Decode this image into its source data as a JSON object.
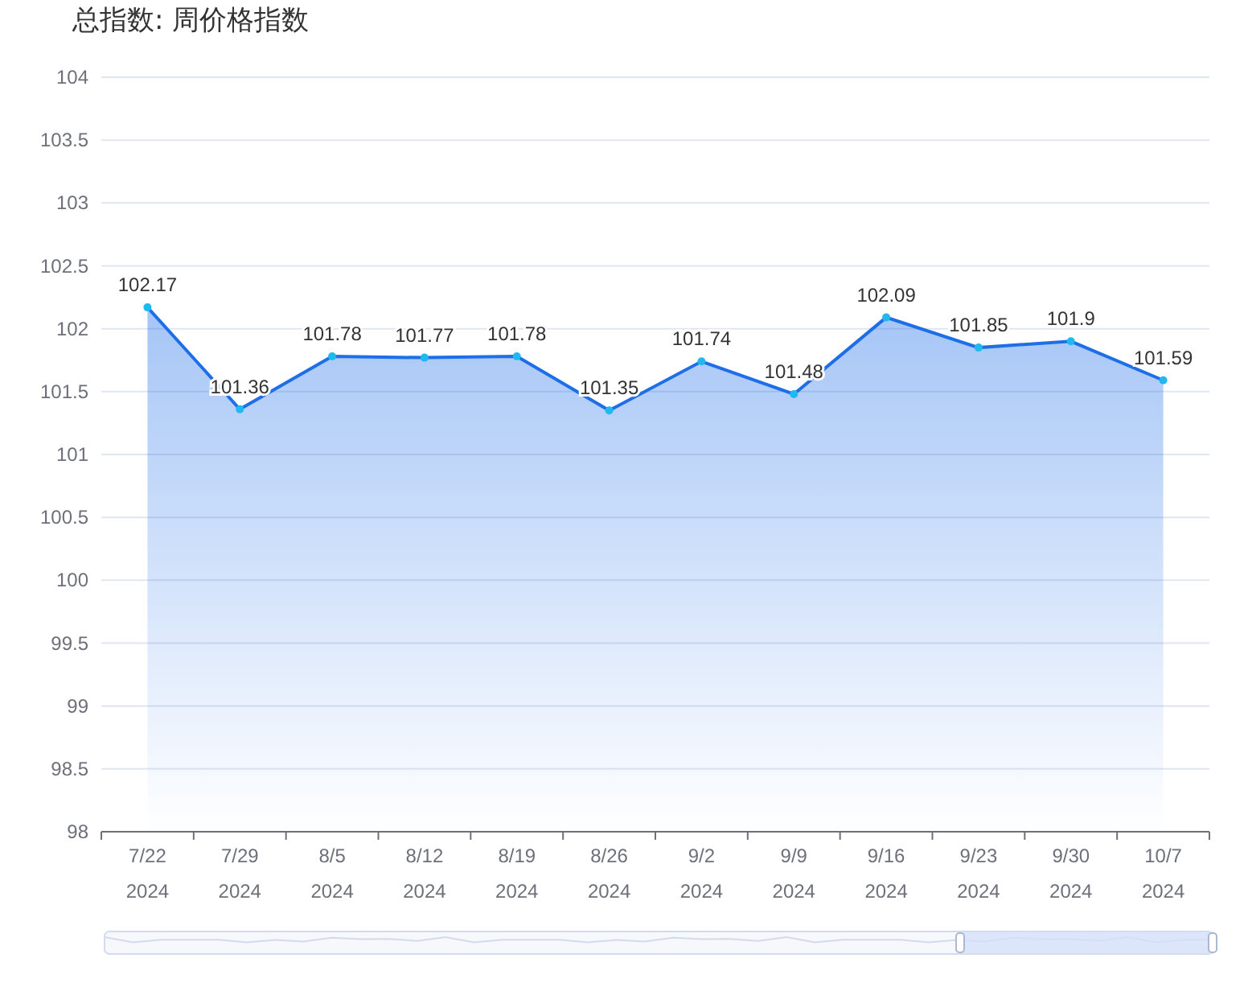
{
  "title": "总指数: 周价格指数",
  "chart_data": {
    "type": "area",
    "categories": [
      "7/22\n2024",
      "7/29\n2024",
      "8/5\n2024",
      "8/12\n2024",
      "8/19\n2024",
      "8/26\n2024",
      "9/2\n2024",
      "9/9\n2024",
      "9/16\n2024",
      "9/23\n2024",
      "9/30\n2024",
      "10/7\n2024"
    ],
    "series": [
      {
        "color": "#1e6ee8",
        "values": [
          102.17,
          101.36,
          101.78,
          101.77,
          101.78,
          101.35,
          101.74,
          101.48,
          102.09,
          101.85,
          101.9,
          101.59
        ]
      }
    ],
    "ylim": [
      98,
      104
    ],
    "yticks": [
      98,
      98.5,
      99,
      99.5,
      100,
      100.5,
      101,
      101.5,
      102,
      102.5,
      103,
      103.5,
      104
    ],
    "data_labels": true,
    "grid": true
  }
}
